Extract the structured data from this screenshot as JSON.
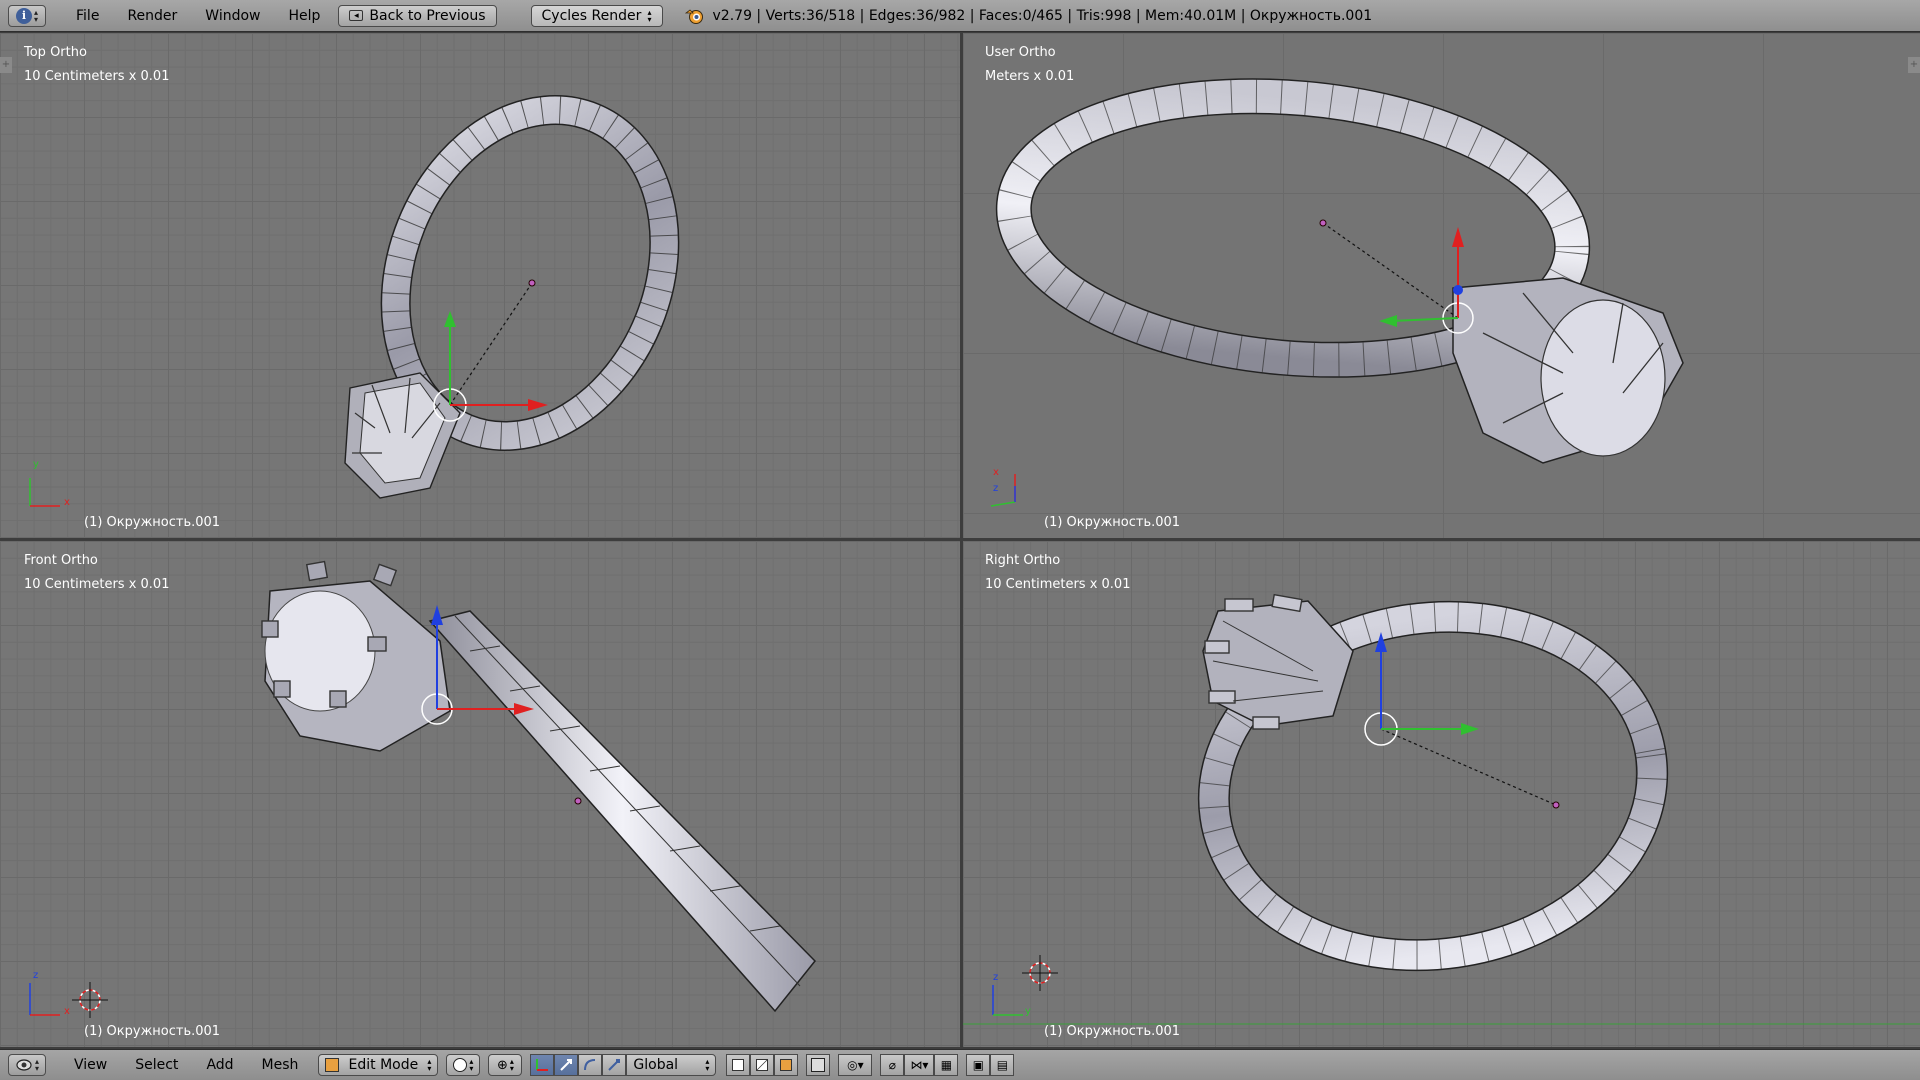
{
  "header": {
    "menu": [
      "File",
      "Render",
      "Window",
      "Help"
    ],
    "back_button": "Back to Previous",
    "render_engine": "Cycles Render",
    "stats": "v2.79 | Verts:36/518 | Edges:36/982 | Faces:0/465 | Tris:998 | Mem:40.01M | Окружность.001"
  },
  "viewports": {
    "top": {
      "name": "Top Ortho",
      "scale": "10 Centimeters x 0.01",
      "object": "(1) Окружность.001",
      "axis_labels": [
        "y",
        "x"
      ]
    },
    "user": {
      "name": "User Ortho",
      "scale": "Meters x 0.01",
      "object": "(1) Окружность.001",
      "axis_labels": [
        "x",
        "z"
      ]
    },
    "front": {
      "name": "Front Ortho",
      "scale": "10 Centimeters x 0.01",
      "object": "(1) Окружность.001",
      "axis_labels": [
        "z",
        "x"
      ]
    },
    "right": {
      "name": "Right Ortho",
      "scale": "10 Centimeters x 0.01",
      "object": "(1) Окружность.001",
      "axis_labels": [
        "z",
        "y"
      ]
    }
  },
  "footer": {
    "menu": [
      "View",
      "Select",
      "Add",
      "Mesh"
    ],
    "mode": "Edit Mode",
    "orientation": "Global"
  },
  "colors": {
    "x_axis": "#e02020",
    "y_axis": "#30c030",
    "z_axis": "#2040e0",
    "selection_blue": "#5a74a4"
  }
}
